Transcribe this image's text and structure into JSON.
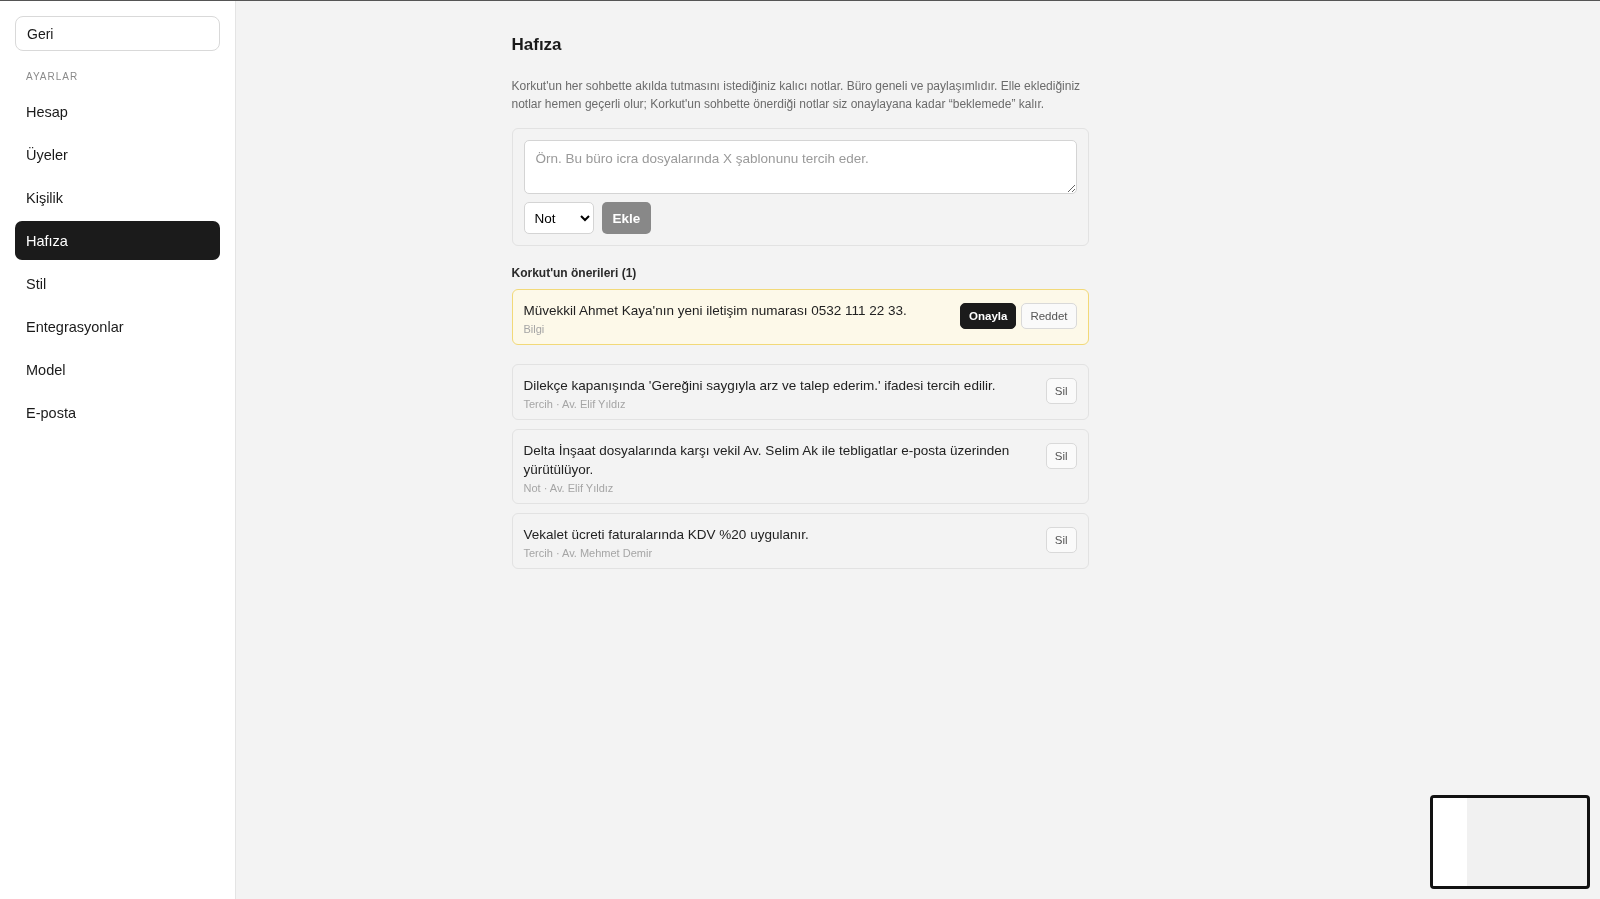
{
  "sidebar": {
    "back_button": "Geri",
    "section_label": "AYARLAR",
    "items": [
      {
        "label": "Hesap",
        "selected": false
      },
      {
        "label": "Üyeler",
        "selected": false
      },
      {
        "label": "Kişilik",
        "selected": false
      },
      {
        "label": "Hafıza",
        "selected": true
      },
      {
        "label": "Stil",
        "selected": false
      },
      {
        "label": "Entegrasyonlar",
        "selected": false
      },
      {
        "label": "Model",
        "selected": false
      },
      {
        "label": "E-posta",
        "selected": false
      }
    ]
  },
  "page": {
    "title": "Hafıza",
    "description": "Korkut'un her sohbette akılda tutmasını istediğiniz kalıcı notlar. Büro geneli ve paylaşımlıdır. Elle eklediğiniz notlar hemen geçerli olur; Korkut'un sohbette önerdiği notlar siz onaylayana kadar “beklemede” kalır.",
    "composer": {
      "placeholder": "Örn. Bu büro icra dosyalarında X şablonunu tercih eder.",
      "type_select": "Not",
      "add_button": "Ekle",
      "disabled": true
    },
    "suggestions_heading": "Korkut'un önerileri (1)",
    "suggestions": [
      {
        "text": "Müvekkil Ahmet Kaya'nın yeni iletişim numarası 0532 111 22 33.",
        "meta": "Bilgi",
        "approve": "Onayla",
        "reject": "Reddet"
      }
    ],
    "notes": [
      {
        "text": "Dilekçe kapanışında 'Gereğini saygıyla arz ve talep ederim.' ifadesi tercih edilir.",
        "meta": "Tercih · Av. Elif Yıldız",
        "delete": "Sil"
      },
      {
        "text": "Delta İnşaat dosyalarında karşı vekil Av. Selim Ak ile tebligatlar e-posta üzerinden yürütülüyor.",
        "meta": "Not · Av. Elif Yıldız",
        "delete": "Sil"
      },
      {
        "text": "Vekalet ücreti faturalarında KDV %20 uygulanır.",
        "meta": "Tercih · Av. Mehmet Demir",
        "delete": "Sil"
      }
    ]
  }
}
